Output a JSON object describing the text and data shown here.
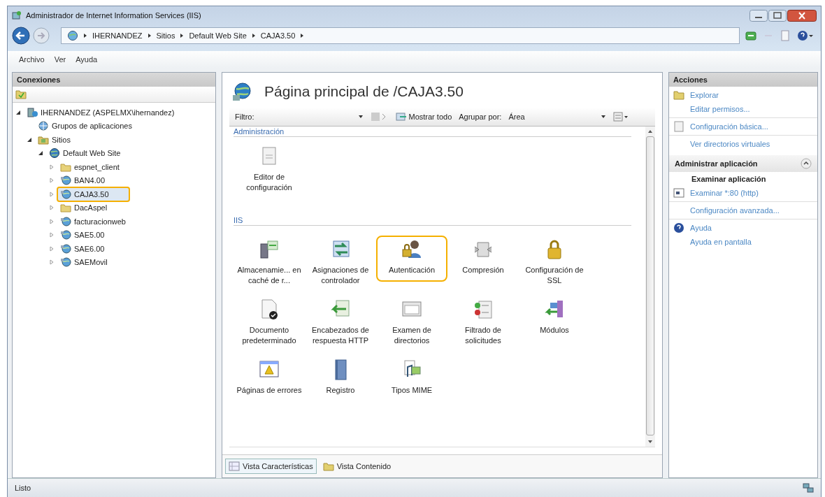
{
  "window": {
    "title": "Administrador de Internet Information Services (IIS)"
  },
  "breadcrumb": [
    "IHERNANDEZ",
    "Sitios",
    "Default Web Site",
    "CAJA3.50"
  ],
  "menu": [
    "Archivo",
    "Ver",
    "Ayuda"
  ],
  "connections": {
    "title": "Conexiones",
    "tree": [
      {
        "label": "IHERNANDEZ (ASPELMX\\ihernandez)",
        "kind": "server",
        "expanded": true,
        "selected": false,
        "highlighted": false,
        "children": [
          {
            "label": "Grupos de aplicaciones",
            "kind": "pool",
            "selected": false,
            "highlighted": false
          },
          {
            "label": "Sitios",
            "kind": "sites",
            "expanded": true,
            "selected": false,
            "highlighted": false,
            "children": [
              {
                "label": "Default Web Site",
                "kind": "site",
                "expanded": true,
                "selected": false,
                "highlighted": false,
                "children": [
                  {
                    "label": "espnet_client",
                    "kind": "folder",
                    "expanded": false,
                    "selected": false,
                    "highlighted": false
                  },
                  {
                    "label": "BAN4.00",
                    "kind": "app",
                    "expanded": false,
                    "selected": false,
                    "highlighted": false
                  },
                  {
                    "label": "CAJA3.50",
                    "kind": "app",
                    "expanded": false,
                    "selected": true,
                    "highlighted": true
                  },
                  {
                    "label": "DacAspel",
                    "kind": "folder",
                    "expanded": false,
                    "selected": false,
                    "highlighted": false
                  },
                  {
                    "label": "facturacionweb",
                    "kind": "app",
                    "expanded": false,
                    "selected": false,
                    "highlighted": false
                  },
                  {
                    "label": "SAE5.00",
                    "kind": "app",
                    "expanded": false,
                    "selected": false,
                    "highlighted": false
                  },
                  {
                    "label": "SAE6.00",
                    "kind": "app",
                    "expanded": false,
                    "selected": false,
                    "highlighted": false
                  },
                  {
                    "label": "SAEMovil",
                    "kind": "app",
                    "expanded": false,
                    "selected": false,
                    "highlighted": false
                  }
                ]
              }
            ]
          }
        ]
      }
    ]
  },
  "page": {
    "title": "Página principal de /CAJA3.50",
    "toolbar": {
      "filter_label": "Filtro:",
      "show_all": "Mostrar todo",
      "group_label": "Agrupar por:",
      "group_value": "Área"
    },
    "sections": [
      {
        "title": "Administración",
        "items": [
          {
            "label": "Editor de configuración",
            "highlighted": false
          }
        ]
      },
      {
        "title": "IIS",
        "items": [
          {
            "label": "Almacenamie... en caché de r...",
            "highlighted": false
          },
          {
            "label": "Asignaciones de controlador",
            "highlighted": false
          },
          {
            "label": "Autenticación",
            "highlighted": true
          },
          {
            "label": "Compresión",
            "highlighted": false
          },
          {
            "label": "Configuración de SSL",
            "highlighted": false
          },
          {
            "label": "Documento predeterminado",
            "highlighted": false
          },
          {
            "label": "Encabezados de respuesta HTTP",
            "highlighted": false
          },
          {
            "label": "Examen de directorios",
            "highlighted": false
          },
          {
            "label": "Filtrado de solicitudes",
            "highlighted": false
          },
          {
            "label": "Módulos",
            "highlighted": false
          },
          {
            "label": "Páginas de errores",
            "highlighted": false
          },
          {
            "label": "Registro",
            "highlighted": false
          },
          {
            "label": "Tipos MIME",
            "highlighted": false
          }
        ]
      }
    ],
    "views": [
      {
        "label": "Vista Características",
        "selected": true
      },
      {
        "label": "Vista Contenido",
        "selected": false
      }
    ]
  },
  "actions": {
    "sections": [
      {
        "title": "Acciones",
        "collapsible": false,
        "groups": [
          [
            {
              "label": "Explorar",
              "kind": "folder"
            },
            {
              "label": "Editar permisos...",
              "kind": "plain"
            }
          ],
          [
            {
              "label": "Configuración básica...",
              "kind": "page"
            }
          ],
          [
            {
              "label": "Ver directorios virtuales",
              "kind": "plain"
            }
          ]
        ]
      },
      {
        "title": "Administrar aplicación",
        "collapsible": true,
        "subtitle": "Examinar aplicación",
        "groups": [
          [
            {
              "label": "Examinar *:80 (http)",
              "kind": "browser"
            }
          ],
          [
            {
              "label": "Configuración avanzada...",
              "kind": "plain"
            }
          ],
          [
            {
              "label": "Ayuda",
              "kind": "help"
            },
            {
              "label": "Ayuda en pantalla",
              "kind": "plain"
            }
          ]
        ]
      }
    ]
  },
  "status_bar": {
    "text": "Listo"
  }
}
